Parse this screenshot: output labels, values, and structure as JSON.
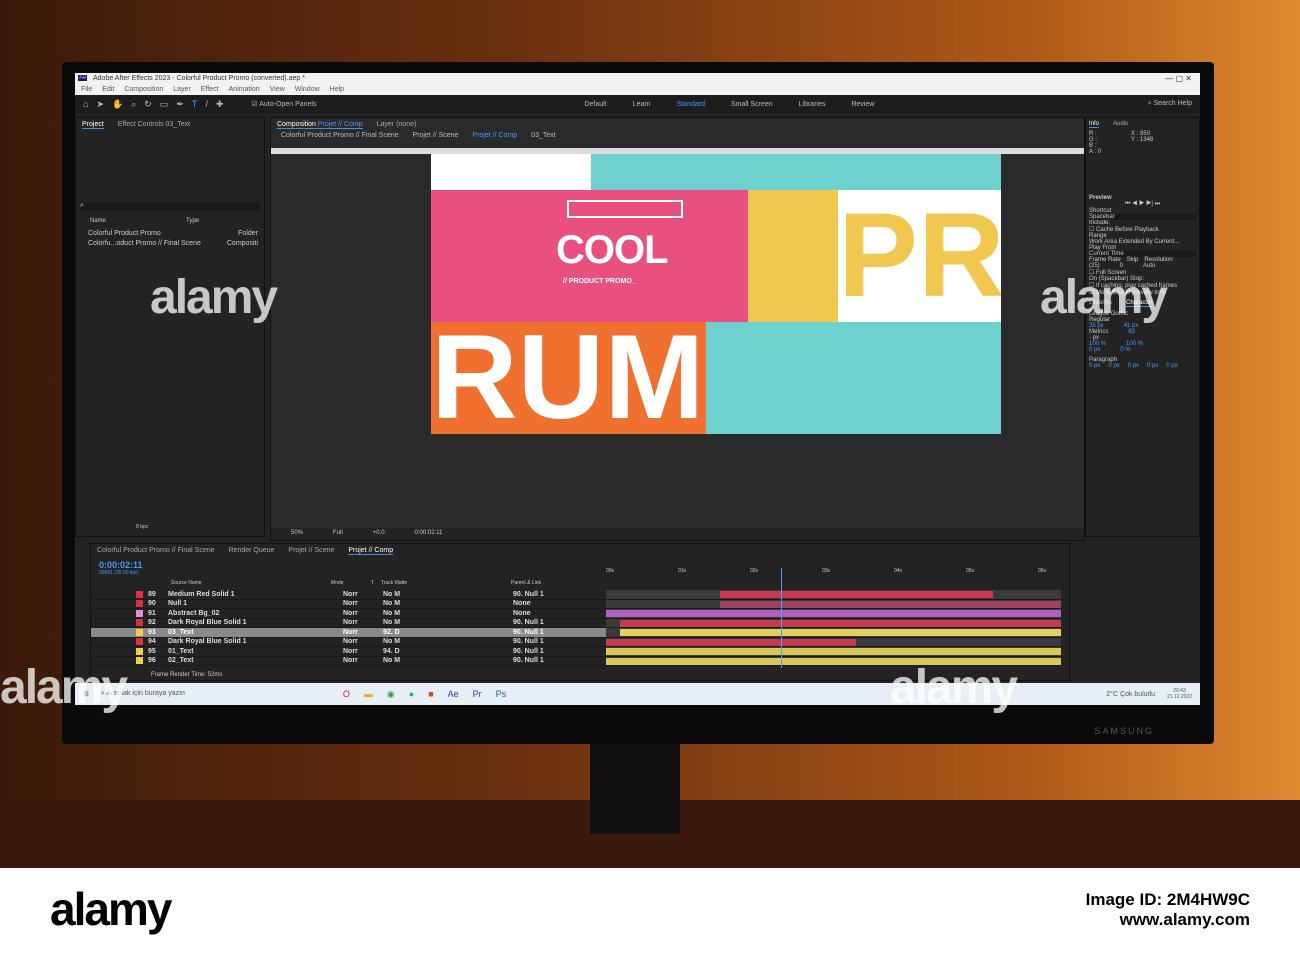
{
  "window": {
    "title": "Adobe After Effects 2023 - Colorful Product Promo (converted).aep *",
    "app_badge": "Ae"
  },
  "menu": [
    "File",
    "Edit",
    "Composition",
    "Layer",
    "Effect",
    "Animation",
    "View",
    "Window",
    "Help"
  ],
  "toolbar": {
    "auto_open": "Auto-Open Panels",
    "workspaces": [
      "Default",
      "Learn",
      "Standard",
      "Small Screen",
      "Libraries",
      "Review"
    ],
    "search": "Search Help"
  },
  "project": {
    "tab": "Project",
    "effect_tab": "Effect Controls 03_Text",
    "cols": [
      "Name",
      "Type"
    ],
    "items": [
      {
        "name": "Colorful Product Promo",
        "type": "Folder"
      },
      {
        "name": "Colorfu...oduct Promo // Final Scene",
        "type": "Compositi"
      }
    ],
    "bpc": "8 bpc"
  },
  "composition": {
    "tab_prefix": "Composition",
    "tab_name": "Projet // Comp",
    "layer_tab": "Layer (none)",
    "breadcrumbs": [
      "Colorful Product Promo // Final Scene",
      "Projet // Scene",
      "Projet // Comp",
      "03_Text"
    ],
    "headline": "COOL",
    "subline": "// PRODUCT PROMO_",
    "zoom": "50%",
    "resolution": "Full",
    "exposure": "+0,0",
    "timecode": "0:00:02:11"
  },
  "info": {
    "tabs": [
      "Info",
      "Audio"
    ],
    "r": "R :",
    "g": "G :",
    "b": "B :",
    "a": "A : 0",
    "x": "X : 850",
    "y": "Y : 1348"
  },
  "preview": {
    "title": "Preview",
    "shortcut_label": "Shortcut",
    "shortcut": "Spacebar",
    "include": "Include:",
    "cache": "Cache Before Playback",
    "range_label": "Range",
    "range": "Work Area Extended By Current...",
    "play_from_label": "Play From",
    "play_from": "Current Time",
    "frame_rate_label": "Frame Rate",
    "skip_label": "Skip",
    "resolution_label": "Resolution",
    "frame_rate": "(25)",
    "skip": "0",
    "resolution": "Auto",
    "full_screen": "Full Screen",
    "stop_label": "On (Spacebar) Stop:",
    "if_caching": "If caching, play cached frames",
    "move_time": "Move time to preview time"
  },
  "character": {
    "tabs": [
      "Libraries",
      "Character"
    ],
    "font": "League Gothic",
    "style": "Regular",
    "size": "35 px",
    "leading": "41 px",
    "kerning": "Metrics",
    "tracking": "63",
    "stroke": "- px",
    "vscale": "100 %",
    "hscale": "100 %",
    "baseline": "0 px",
    "tsume": "0 %"
  },
  "paragraph": {
    "title": "Paragraph",
    "values": [
      "0 px",
      "0 px",
      "0 px",
      "0 px",
      "0 px"
    ]
  },
  "timeline": {
    "tabs": [
      "Colorful Product Promo // Final Scene",
      "Render Queue",
      "Projet // Scene",
      "Projet // Comp"
    ],
    "timecode": "0:00:02:11",
    "fps": "00061 (25.00 fps)",
    "headers": [
      "Source Name",
      "Mode",
      "T",
      "Track Matte",
      "Parent & Link"
    ],
    "ruler": [
      "00s",
      "01s",
      "02s",
      "03s",
      "04s",
      "05s",
      "06s"
    ],
    "render_time": "Frame Render Time: 52ms",
    "layers": [
      {
        "num": "89",
        "name": "Medium Red Solid 1",
        "color": "#e03040",
        "mode": "Norr",
        "matte": "No M",
        "parent": "90. Null 1",
        "bar": "#c83a50",
        "start": 0.25,
        "end": 0.85
      },
      {
        "num": "90",
        "name": "Null 1",
        "color": "#e03040",
        "mode": "Norr",
        "matte": "No M",
        "parent": "None",
        "bar": "#a04060",
        "start": 0.25,
        "end": 1
      },
      {
        "num": "91",
        "name": "Abstract Bg_02",
        "color": "#e090e0",
        "mode": "Norr",
        "matte": "No M",
        "parent": "None",
        "bar": "#b060c0",
        "start": 0,
        "end": 1
      },
      {
        "num": "92",
        "name": "Dark Royal Blue Solid 1",
        "color": "#e03040",
        "mode": "Norr",
        "matte": "No M",
        "parent": "90. Null 1",
        "bar": "#c83a50",
        "start": 0.03,
        "end": 1
      },
      {
        "num": "93",
        "name": "03_Text",
        "color": "#f0d040",
        "mode": "Norr",
        "matte": "92. D",
        "parent": "90. Null 1",
        "bar": "#e0d060",
        "start": 0.03,
        "end": 1,
        "selected": true
      },
      {
        "num": "94",
        "name": "Dark Royal Blue Solid 1",
        "color": "#e03040",
        "mode": "Norr",
        "matte": "No M",
        "parent": "90. Null 1",
        "bar": "#c83a50",
        "start": 0,
        "end": 0.55
      },
      {
        "num": "95",
        "name": "01_Text",
        "color": "#f0d040",
        "mode": "Norr",
        "matte": "94. D",
        "parent": "90. Null 1",
        "bar": "#d8c858",
        "start": 0,
        "end": 1
      },
      {
        "num": "96",
        "name": "02_Text",
        "color": "#f0d040",
        "mode": "Norr",
        "matte": "No M",
        "parent": "90. Null 1",
        "bar": "#d8c858",
        "start": 0,
        "end": 1
      }
    ]
  },
  "taskbar": {
    "search": "Aramak için buraya yazın",
    "weather": "2°C  Çok bulutlu",
    "time": "20:43",
    "date": "21.12.2022"
  },
  "monitor_brand": "SAMSUNG",
  "stock": {
    "logo": "alamy",
    "watermark": "alamy",
    "image_id": "2M4HW9C",
    "url": "www.alamy.com"
  }
}
